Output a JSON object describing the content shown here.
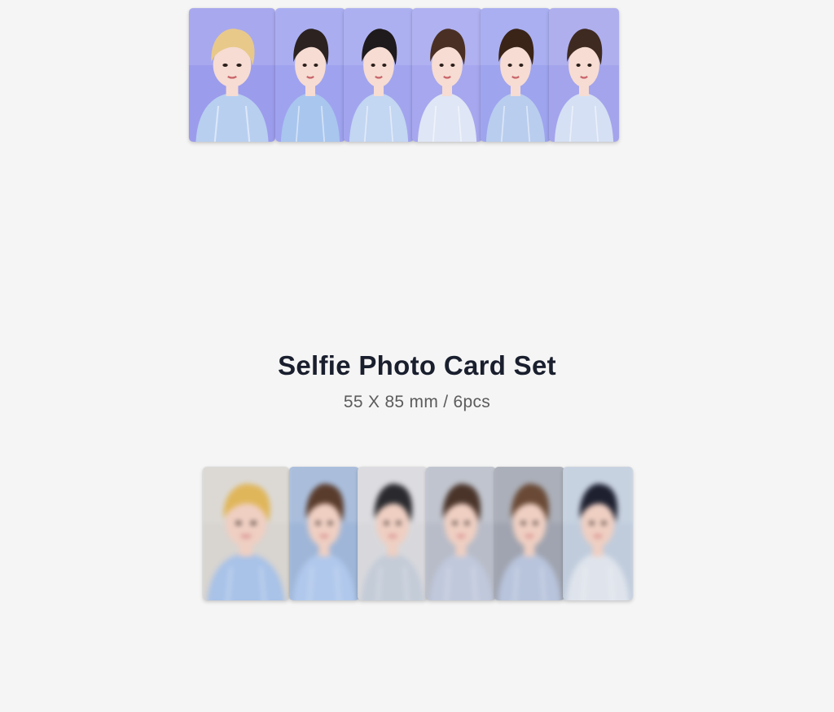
{
  "product": {
    "title": "Selfie Photo Card Set",
    "spec": "55 X 85 mm / 6pcs"
  },
  "top_cards": [
    {
      "subject": "photo-card-portrait",
      "hair": "#e8c98a",
      "bg": "#9c9cec",
      "shirt": "#b8cff0"
    },
    {
      "subject": "photo-card-portrait",
      "hair": "#2c2220",
      "bg": "#9fa3ef",
      "shirt": "#a9c6ee"
    },
    {
      "subject": "photo-card-portrait",
      "hair": "#1f1a1c",
      "bg": "#a2a5ee",
      "shirt": "#c3d6f2"
    },
    {
      "subject": "photo-card-portrait",
      "hair": "#4a3024",
      "bg": "#a6a7ee",
      "shirt": "#dfe6f5"
    },
    {
      "subject": "photo-card-portrait",
      "hair": "#3a2418",
      "bg": "#9ea4ee",
      "shirt": "#b9cdee"
    },
    {
      "subject": "photo-card-portrait",
      "hair": "#3e2a20",
      "bg": "#a4a4ec",
      "shirt": "#d5e0f4"
    }
  ],
  "bottom_cards": [
    {
      "subject": "selfie-card-blurred",
      "hair": "#e0b65a",
      "bg": "#d8d4d0",
      "shirt": "#a8c2e8"
    },
    {
      "subject": "selfie-card-blurred",
      "hair": "#5a3c2c",
      "bg": "#9fb6d8",
      "shirt": "#b0c8ec"
    },
    {
      "subject": "selfie-card-blurred",
      "hair": "#2a2a2e",
      "bg": "#d8d8dc",
      "shirt": "#c4ccd8"
    },
    {
      "subject": "selfie-card-blurred",
      "hair": "#4a342a",
      "bg": "#b8bcc8",
      "shirt": "#c0c8dc"
    },
    {
      "subject": "selfie-card-blurred",
      "hair": "#6a4a36",
      "bg": "#a0a4b0",
      "shirt": "#b8c4dc"
    },
    {
      "subject": "selfie-card-blurred",
      "hair": "#1e2030",
      "bg": "#c0ccdc",
      "shirt": "#dfe4ec"
    }
  ]
}
